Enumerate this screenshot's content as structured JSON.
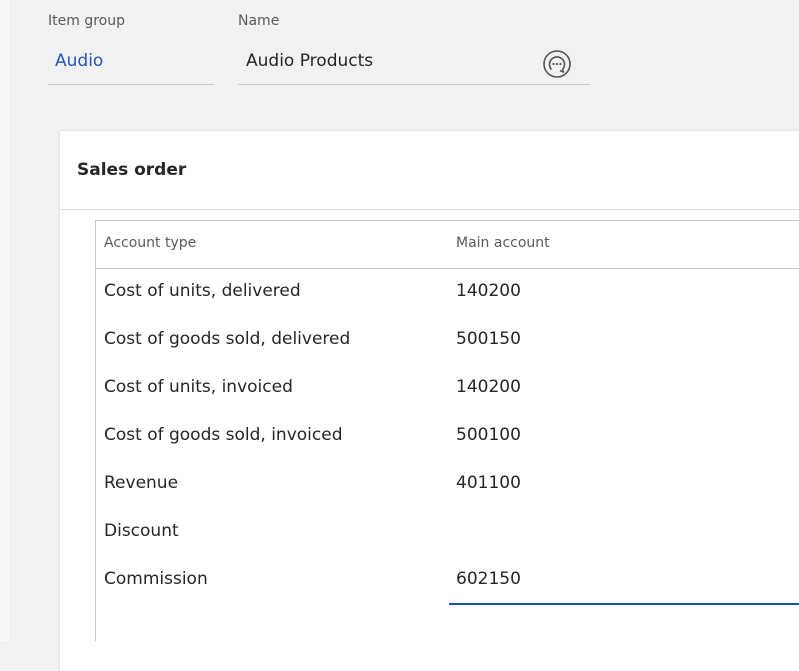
{
  "header": {
    "item_group": {
      "label": "Item group",
      "value": "Audio"
    },
    "name": {
      "label": "Name",
      "value": "Audio Products"
    }
  },
  "icons": {
    "lookup": "chat-bubble-icon"
  },
  "colors": {
    "link": "#2456b7",
    "active_accent": "#1e4fb3",
    "background": "#f1f1f1",
    "card": "#ffffff"
  },
  "section": {
    "title": "Sales order",
    "columns": [
      "Account type",
      "Main account"
    ],
    "rows": [
      {
        "account_type": "Cost of units, delivered",
        "main_account": "140200"
      },
      {
        "account_type": "Cost of goods sold, delivered",
        "main_account": "500150"
      },
      {
        "account_type": "Cost of units, invoiced",
        "main_account": "140200"
      },
      {
        "account_type": "Cost of goods sold, invoiced",
        "main_account": "500100"
      },
      {
        "account_type": "Revenue",
        "main_account": "401100"
      },
      {
        "account_type": "Discount",
        "main_account": ""
      },
      {
        "account_type": "Commission",
        "main_account": "602150"
      }
    ]
  }
}
